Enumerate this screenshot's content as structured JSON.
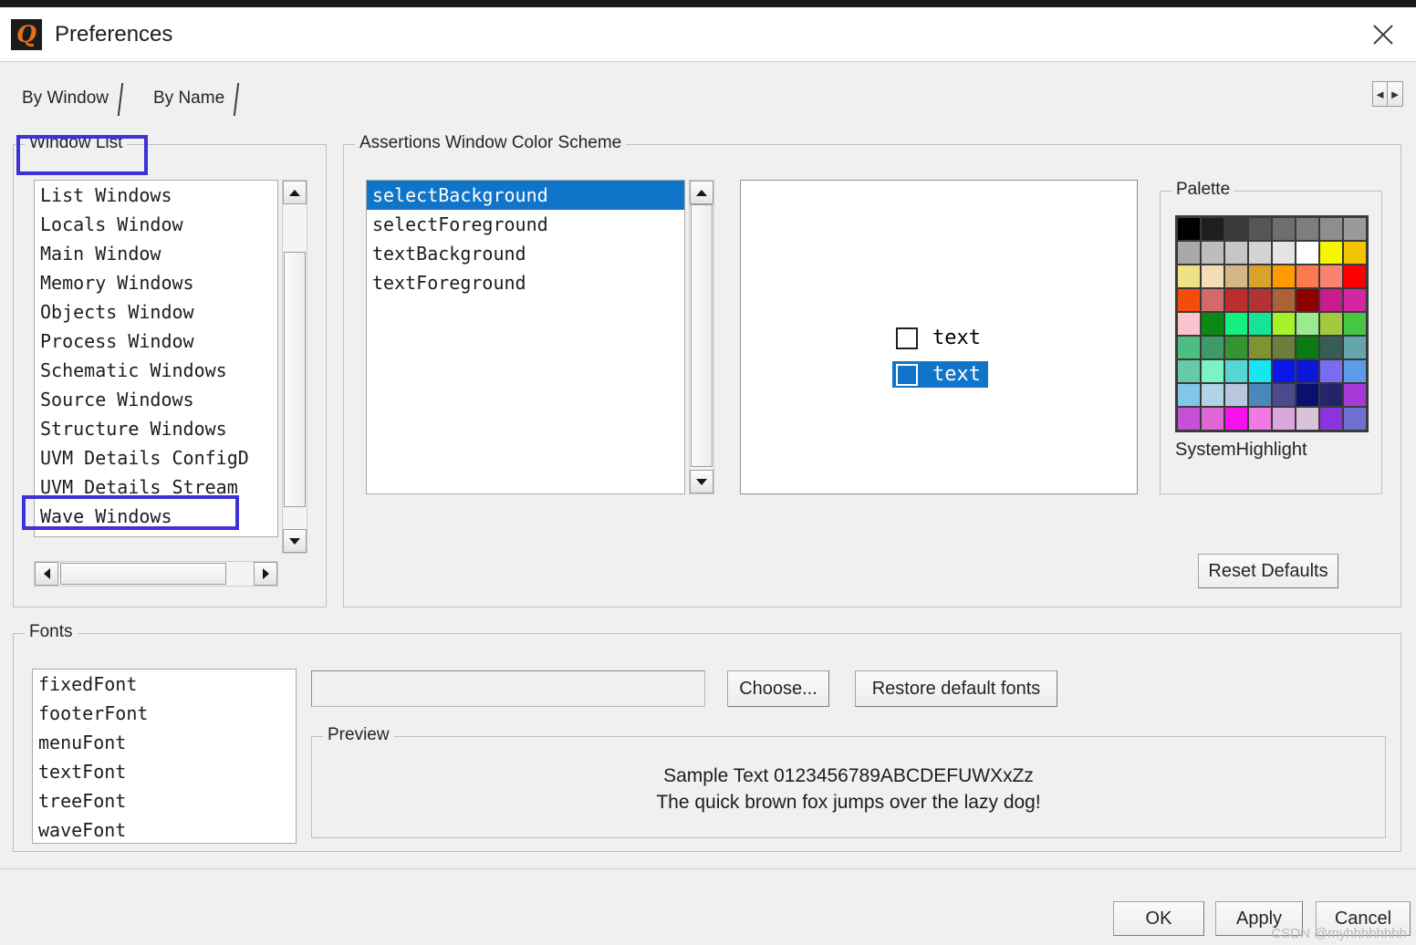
{
  "window": {
    "title": "Preferences",
    "app_icon": "app-logo-icon",
    "close_icon": "close-icon"
  },
  "tabs": [
    {
      "label": "By Window",
      "selected": true
    },
    {
      "label": "By Name",
      "selected": false
    }
  ],
  "tab_arrows": {
    "left": "◄",
    "right": "►"
  },
  "window_list": {
    "legend": "Window List",
    "items": [
      "List Windows",
      "Locals Window",
      "Main Window",
      "Memory Windows",
      "Objects Window",
      "Process Window",
      "Schematic Windows",
      "Source Windows",
      "Structure Windows",
      "UVM Details ConfigD",
      "UVM Details Stream",
      "Wave Windows"
    ],
    "highlighted_item": "Wave Windows",
    "highlight_color": "#3d32d8"
  },
  "color_scheme": {
    "legend": "Assertions Window Color Scheme",
    "items": [
      "selectBackground",
      "selectForeground",
      "textBackground",
      "textForeground"
    ],
    "selected_item": "selectBackground",
    "selection_bg": "#1074c8",
    "preview": {
      "row_normal_label": "text",
      "row_selected_label": "text",
      "selected_bg": "#1074c8"
    }
  },
  "palette": {
    "legend": "Palette",
    "selected_name": "SystemHighlight",
    "rows": [
      [
        "#000000",
        "#1e1e1e",
        "#3a3a3a",
        "#565656",
        "#6e6e6e",
        "#7e7e7e",
        "#8e8e8e",
        "#9a9a9a"
      ],
      [
        "#a8a8a8",
        "#bdbdbd",
        "#c6c6c6",
        "#d3d3d3",
        "#e4e4e4",
        "#ffffff",
        "#f6f600",
        "#f5c400"
      ],
      [
        "#ece287",
        "#f2ddb6",
        "#d5b687",
        "#d8a22c",
        "#ff9a00",
        "#fd7a4e",
        "#fa8271",
        "#fa0000"
      ],
      [
        "#f54b0c",
        "#d36a69",
        "#bc2d2d",
        "#b33333",
        "#ab6237",
        "#8c0000",
        "#ca1b8e",
        "#d227a0"
      ],
      [
        "#fcc3cf",
        "#0a8a14",
        "#13f07d",
        "#15e39a",
        "#a6f229",
        "#99eb8e",
        "#a3c93c",
        "#46c642"
      ],
      [
        "#4dbe83",
        "#3f9a68",
        "#349530",
        "#7e9430",
        "#6b7e3c",
        "#0a7a14",
        "#375d54",
        "#63a4ad"
      ],
      [
        "#68c9a9",
        "#7bf3c6",
        "#57d6d1",
        "#17e5f2",
        "#0b17e8",
        "#0b17d6",
        "#7a6cf0",
        "#5f9beb"
      ],
      [
        "#82c7e8",
        "#b2d3e8",
        "#b8c6de",
        "#4a87bb",
        "#4a4a8f",
        "#0a1070",
        "#24246b",
        "#a63ad6"
      ],
      [
        "#c552d6",
        "#e066d6",
        "#f711ec",
        "#ef7ae3",
        "#dba6dd",
        "#d8c3da",
        "#8c33e0",
        "#6f6fd1"
      ]
    ]
  },
  "reset_button": {
    "label": "Reset Defaults"
  },
  "fonts": {
    "legend": "Fonts",
    "items": [
      "fixedFont",
      "footerFont",
      "menuFont",
      "textFont",
      "treeFont",
      "waveFont"
    ],
    "field_value": "",
    "field_placeholder": "",
    "choose_button": "Choose...",
    "restore_button": "Restore default fonts",
    "preview": {
      "legend": "Preview",
      "line1": "Sample Text 0123456789ABCDEFUWXxZz",
      "line2": "The quick brown fox jumps over the lazy dog!"
    }
  },
  "footer": {
    "ok": "OK",
    "apply": "Apply",
    "cancel": "Cancel"
  },
  "watermark": "CSDN @myhhhhhhhh"
}
